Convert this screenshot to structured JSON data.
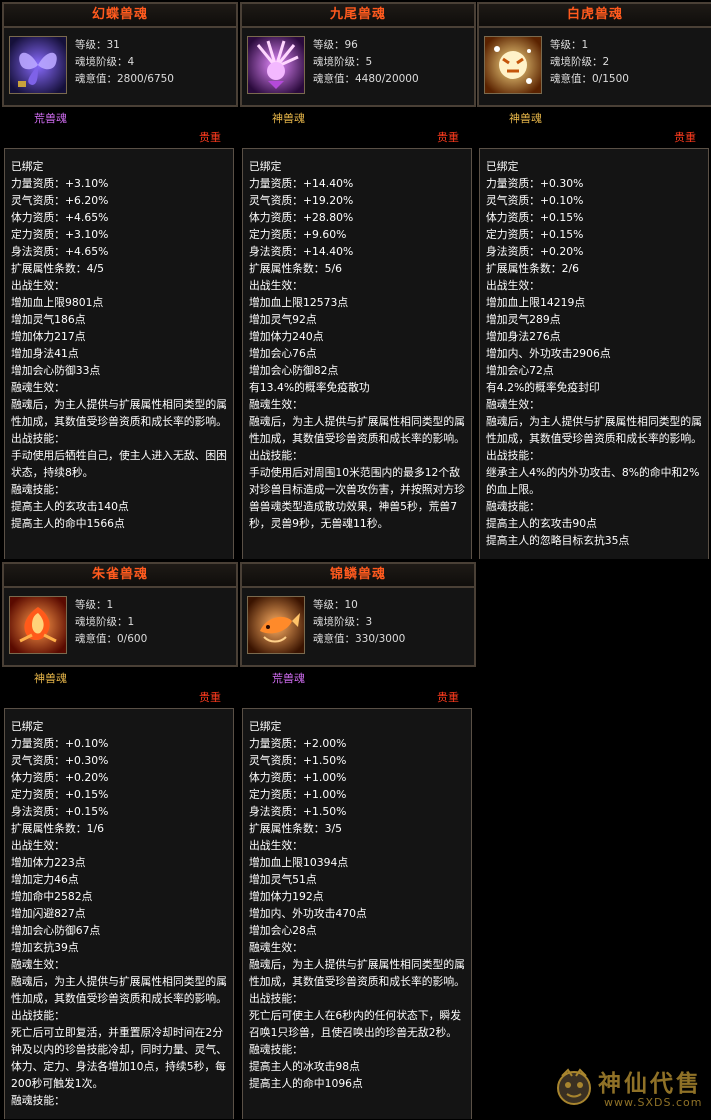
{
  "cards": [
    {
      "title": "幻蝶兽魂",
      "icon": "butterfly-soul-icon",
      "level": "等级：31",
      "stage": "魂境阶级：4",
      "soul": "魂意值：2800/6750",
      "type": "荒兽魂",
      "rarity": "贵重",
      "lines": [
        {
          "t": "已绑定",
          "c": "white"
        },
        {
          "t": "力量资质：+3.10%",
          "c": "white"
        },
        {
          "t": "灵气资质：+6.20%",
          "c": "white"
        },
        {
          "t": "体力资质：+4.65%",
          "c": "white"
        },
        {
          "t": "定力资质：+3.10%",
          "c": "white"
        },
        {
          "t": "身法资质：+4.65%",
          "c": "white"
        },
        {
          "t": "扩展属性条数：4/5",
          "c": "white"
        },
        {
          "t": "出战生效：",
          "c": "white"
        },
        {
          "t": "增加血上限9801点",
          "c": "purple"
        },
        {
          "t": "增加灵气186点",
          "c": "cyan"
        },
        {
          "t": "增加体力217点",
          "c": "purple"
        },
        {
          "t": "增加身法41点",
          "c": "white"
        },
        {
          "t": "增加会心防御33点",
          "c": "gray"
        },
        {
          "t": "融魂生效：",
          "c": "white"
        },
        {
          "t": "融魂后，为主人提供与扩展属性相同类型的属性加成，其数值受珍兽资质和成长率的影响。",
          "c": "white",
          "p": true
        },
        {
          "t": "出战技能：",
          "c": "green"
        },
        {
          "t": "手动使用后牺牲自己，使主人进入无敌、困困状态，持续8秒。",
          "c": "green",
          "p": true
        },
        {
          "t": "融魂技能：",
          "c": "green"
        },
        {
          "t": "提高主人的玄攻击140点",
          "c": "green"
        },
        {
          "t": "提高主人的命中1566点",
          "c": "green"
        }
      ]
    },
    {
      "title": "九尾兽魂",
      "icon": "nine-tail-fox-soul-icon",
      "level": "等级：96",
      "stage": "魂境阶级：5",
      "soul": "魂意值：4480/20000",
      "type": "神兽魂",
      "rarity": "贵重",
      "lines": [
        {
          "t": "已绑定",
          "c": "white"
        },
        {
          "t": "力量资质：+14.40%",
          "c": "white"
        },
        {
          "t": "灵气资质：+19.20%",
          "c": "white"
        },
        {
          "t": "体力资质：+28.80%",
          "c": "white"
        },
        {
          "t": "定力资质：+9.60%",
          "c": "white"
        },
        {
          "t": "身法资质：+14.40%",
          "c": "white"
        },
        {
          "t": "扩展属性条数：5/6",
          "c": "white"
        },
        {
          "t": "出战生效：",
          "c": "white"
        },
        {
          "t": "增加血上限12573点",
          "c": "orange"
        },
        {
          "t": "增加灵气92点",
          "c": "green"
        },
        {
          "t": "增加体力240点",
          "c": "purple"
        },
        {
          "t": "增加会心76点",
          "c": "orange"
        },
        {
          "t": "增加会心防御82点",
          "c": "orange"
        },
        {
          "t": "有13.4%的概率免疫散功",
          "c": "gray"
        },
        {
          "t": "融魂生效：",
          "c": "white"
        },
        {
          "t": "融魂后，为主人提供与扩展属性相同类型的属性加成，其数值受珍兽资质和成长率的影响。",
          "c": "white",
          "p": true
        },
        {
          "t": "出战技能：",
          "c": "green"
        },
        {
          "t": "手动使用后对周围10米范围内的最多12个敌对珍兽目标造成一次兽攻伤害，并按照对方珍兽兽魂类型造成散功效果，神兽5秒，荒兽7秒，灵兽9秒，无兽魂11秒。",
          "c": "green",
          "p": true
        }
      ]
    },
    {
      "title": "白虎兽魂",
      "icon": "white-tiger-soul-icon",
      "level": "等级：1",
      "stage": "魂境阶级：2",
      "soul": "魂意值：0/1500",
      "type": "神兽魂",
      "rarity": "贵重",
      "lines": [
        {
          "t": "已绑定",
          "c": "white"
        },
        {
          "t": "力量资质：+0.30%",
          "c": "white"
        },
        {
          "t": "灵气资质：+0.10%",
          "c": "white"
        },
        {
          "t": "体力资质：+0.15%",
          "c": "white"
        },
        {
          "t": "定力资质：+0.15%",
          "c": "white"
        },
        {
          "t": "身法资质：+0.20%",
          "c": "white"
        },
        {
          "t": "扩展属性条数：2/6",
          "c": "white"
        },
        {
          "t": "出战生效：",
          "c": "white"
        },
        {
          "t": "增加血上限14219点",
          "c": "orange"
        },
        {
          "t": "增加灵气289点",
          "c": "orange"
        },
        {
          "t": "增加身法276点",
          "c": "gray"
        },
        {
          "t": "增加内、外功攻击2906点",
          "c": "gray"
        },
        {
          "t": "增加会心72点",
          "c": "gray"
        },
        {
          "t": "有4.2%的概率免疫封印",
          "c": "gray"
        },
        {
          "t": "融魂生效：",
          "c": "white"
        },
        {
          "t": "融魂后，为主人提供与扩展属性相同类型的属性加成，其数值受珍兽资质和成长率的影响。",
          "c": "white",
          "p": true
        },
        {
          "t": "出战技能：",
          "c": "green"
        },
        {
          "t": "继承主人4%的内外功攻击、8%的命中和2%的血上限。",
          "c": "green",
          "p": true
        },
        {
          "t": "融魂技能：",
          "c": "green"
        },
        {
          "t": "提高主人的玄攻击90点",
          "c": "green"
        },
        {
          "t": "提高主人的忽略目标玄抗35点",
          "c": "green"
        }
      ]
    },
    {
      "title": "朱雀兽魂",
      "icon": "vermilion-bird-soul-icon",
      "level": "等级：1",
      "stage": "魂境阶级：1",
      "soul": "魂意值：0/600",
      "type": "神兽魂",
      "rarity": "贵重",
      "lines": [
        {
          "t": "已绑定",
          "c": "white"
        },
        {
          "t": "力量资质：+0.10%",
          "c": "white"
        },
        {
          "t": "灵气资质：+0.30%",
          "c": "white"
        },
        {
          "t": "体力资质：+0.20%",
          "c": "white"
        },
        {
          "t": "定力资质：+0.15%",
          "c": "white"
        },
        {
          "t": "身法资质：+0.15%",
          "c": "white"
        },
        {
          "t": "扩展属性条数：1/6",
          "c": "white"
        },
        {
          "t": "出战生效：",
          "c": "white"
        },
        {
          "t": "增加体力223点",
          "c": "purple"
        },
        {
          "t": "增加定力46点",
          "c": "gray"
        },
        {
          "t": "增加命中2582点",
          "c": "gray"
        },
        {
          "t": "增加闪避827点",
          "c": "gray"
        },
        {
          "t": "增加会心防御67点",
          "c": "gray"
        },
        {
          "t": "增加玄抗39点",
          "c": "gray"
        },
        {
          "t": "融魂生效：",
          "c": "white"
        },
        {
          "t": "融魂后，为主人提供与扩展属性相同类型的属性加成，其数值受珍兽资质和成长率的影响。",
          "c": "white",
          "p": true
        },
        {
          "t": "出战技能：",
          "c": "green"
        },
        {
          "t": "死亡后可立即复活，并重置原冷却时间在2分钟及以内的珍兽技能冷却，同时力量、灵气、体力、定力、身法各增加10点，持续5秒，每200秒可触发1次。",
          "c": "green",
          "p": true
        },
        {
          "t": "融魂技能：",
          "c": "green"
        }
      ]
    },
    {
      "title": "锦鳞兽魂",
      "icon": "brocade-carp-soul-icon",
      "level": "等级：10",
      "stage": "魂境阶级：3",
      "soul": "魂意值：330/3000",
      "type": "荒兽魂",
      "rarity": "贵重",
      "lines": [
        {
          "t": "已绑定",
          "c": "white"
        },
        {
          "t": "力量资质：+2.00%",
          "c": "white"
        },
        {
          "t": "灵气资质：+1.50%",
          "c": "white"
        },
        {
          "t": "体力资质：+1.00%",
          "c": "white"
        },
        {
          "t": "定力资质：+1.00%",
          "c": "white"
        },
        {
          "t": "身法资质：+1.50%",
          "c": "white"
        },
        {
          "t": "扩展属性条数：3/5",
          "c": "white"
        },
        {
          "t": "出战生效：",
          "c": "white"
        },
        {
          "t": "增加血上限10394点",
          "c": "purple"
        },
        {
          "t": "增加灵气51点",
          "c": "white"
        },
        {
          "t": "增加体力192点",
          "c": "purple"
        },
        {
          "t": "增加内、外功攻击470点",
          "c": "gray"
        },
        {
          "t": "增加会心28点",
          "c": "gray"
        },
        {
          "t": "融魂生效：",
          "c": "white"
        },
        {
          "t": "融魂后，为主人提供与扩展属性相同类型的属性加成，其数值受珍兽资质和成长率的影响。",
          "c": "white",
          "p": true
        },
        {
          "t": "出战技能：",
          "c": "green"
        },
        {
          "t": "死亡后可使主人在6秒内的任何状态下，瞬发召唤1只珍兽，且使召唤出的珍兽无敌2秒。",
          "c": "green",
          "p": true
        },
        {
          "t": "融魂技能：",
          "c": "green"
        },
        {
          "t": "提高主人的冰攻击98点",
          "c": "green"
        },
        {
          "t": "提高主人的命中1096点",
          "c": "green"
        }
      ]
    }
  ],
  "watermark": {
    "text": "神仙代售",
    "url": "www.SXDS.com"
  }
}
